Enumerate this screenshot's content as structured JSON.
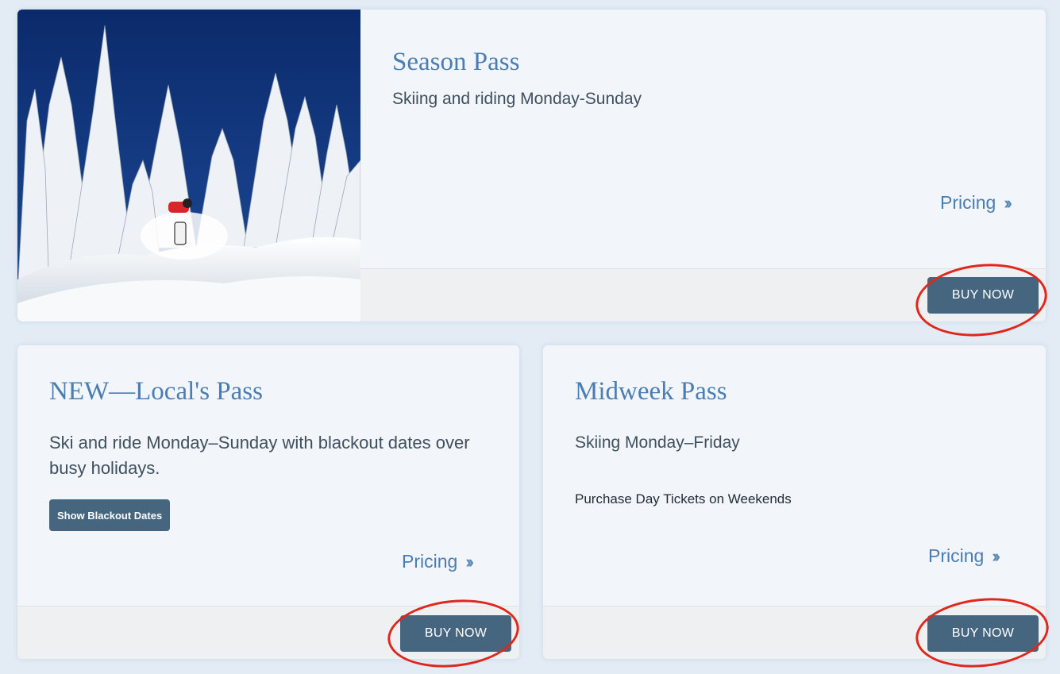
{
  "cards": [
    {
      "title": "Season Pass",
      "subtitle": "Skiing and riding Monday-Sunday",
      "pricing_label": "Pricing",
      "buy_label": "BUY NOW"
    },
    {
      "title": "NEW—Local's Pass",
      "subtitle": "Ski and ride Monday–Sunday with blackout dates over busy holidays.",
      "blackout_label": "Show Blackout Dates",
      "pricing_label": "Pricing",
      "buy_label": "BUY NOW"
    },
    {
      "title": "Midweek Pass",
      "subtitle": "Skiing Monday–Friday",
      "note": "Purchase Day Tickets on Weekends",
      "pricing_label": "Pricing",
      "buy_label": "BUY NOW"
    }
  ],
  "icons": {
    "pricing_chevron": "double-chevron-right-icon",
    "annotation": "red-ellipse-annotation"
  },
  "colors": {
    "accent": "#4a7db3",
    "button": "#46667f",
    "annotation": "#e0271b"
  }
}
